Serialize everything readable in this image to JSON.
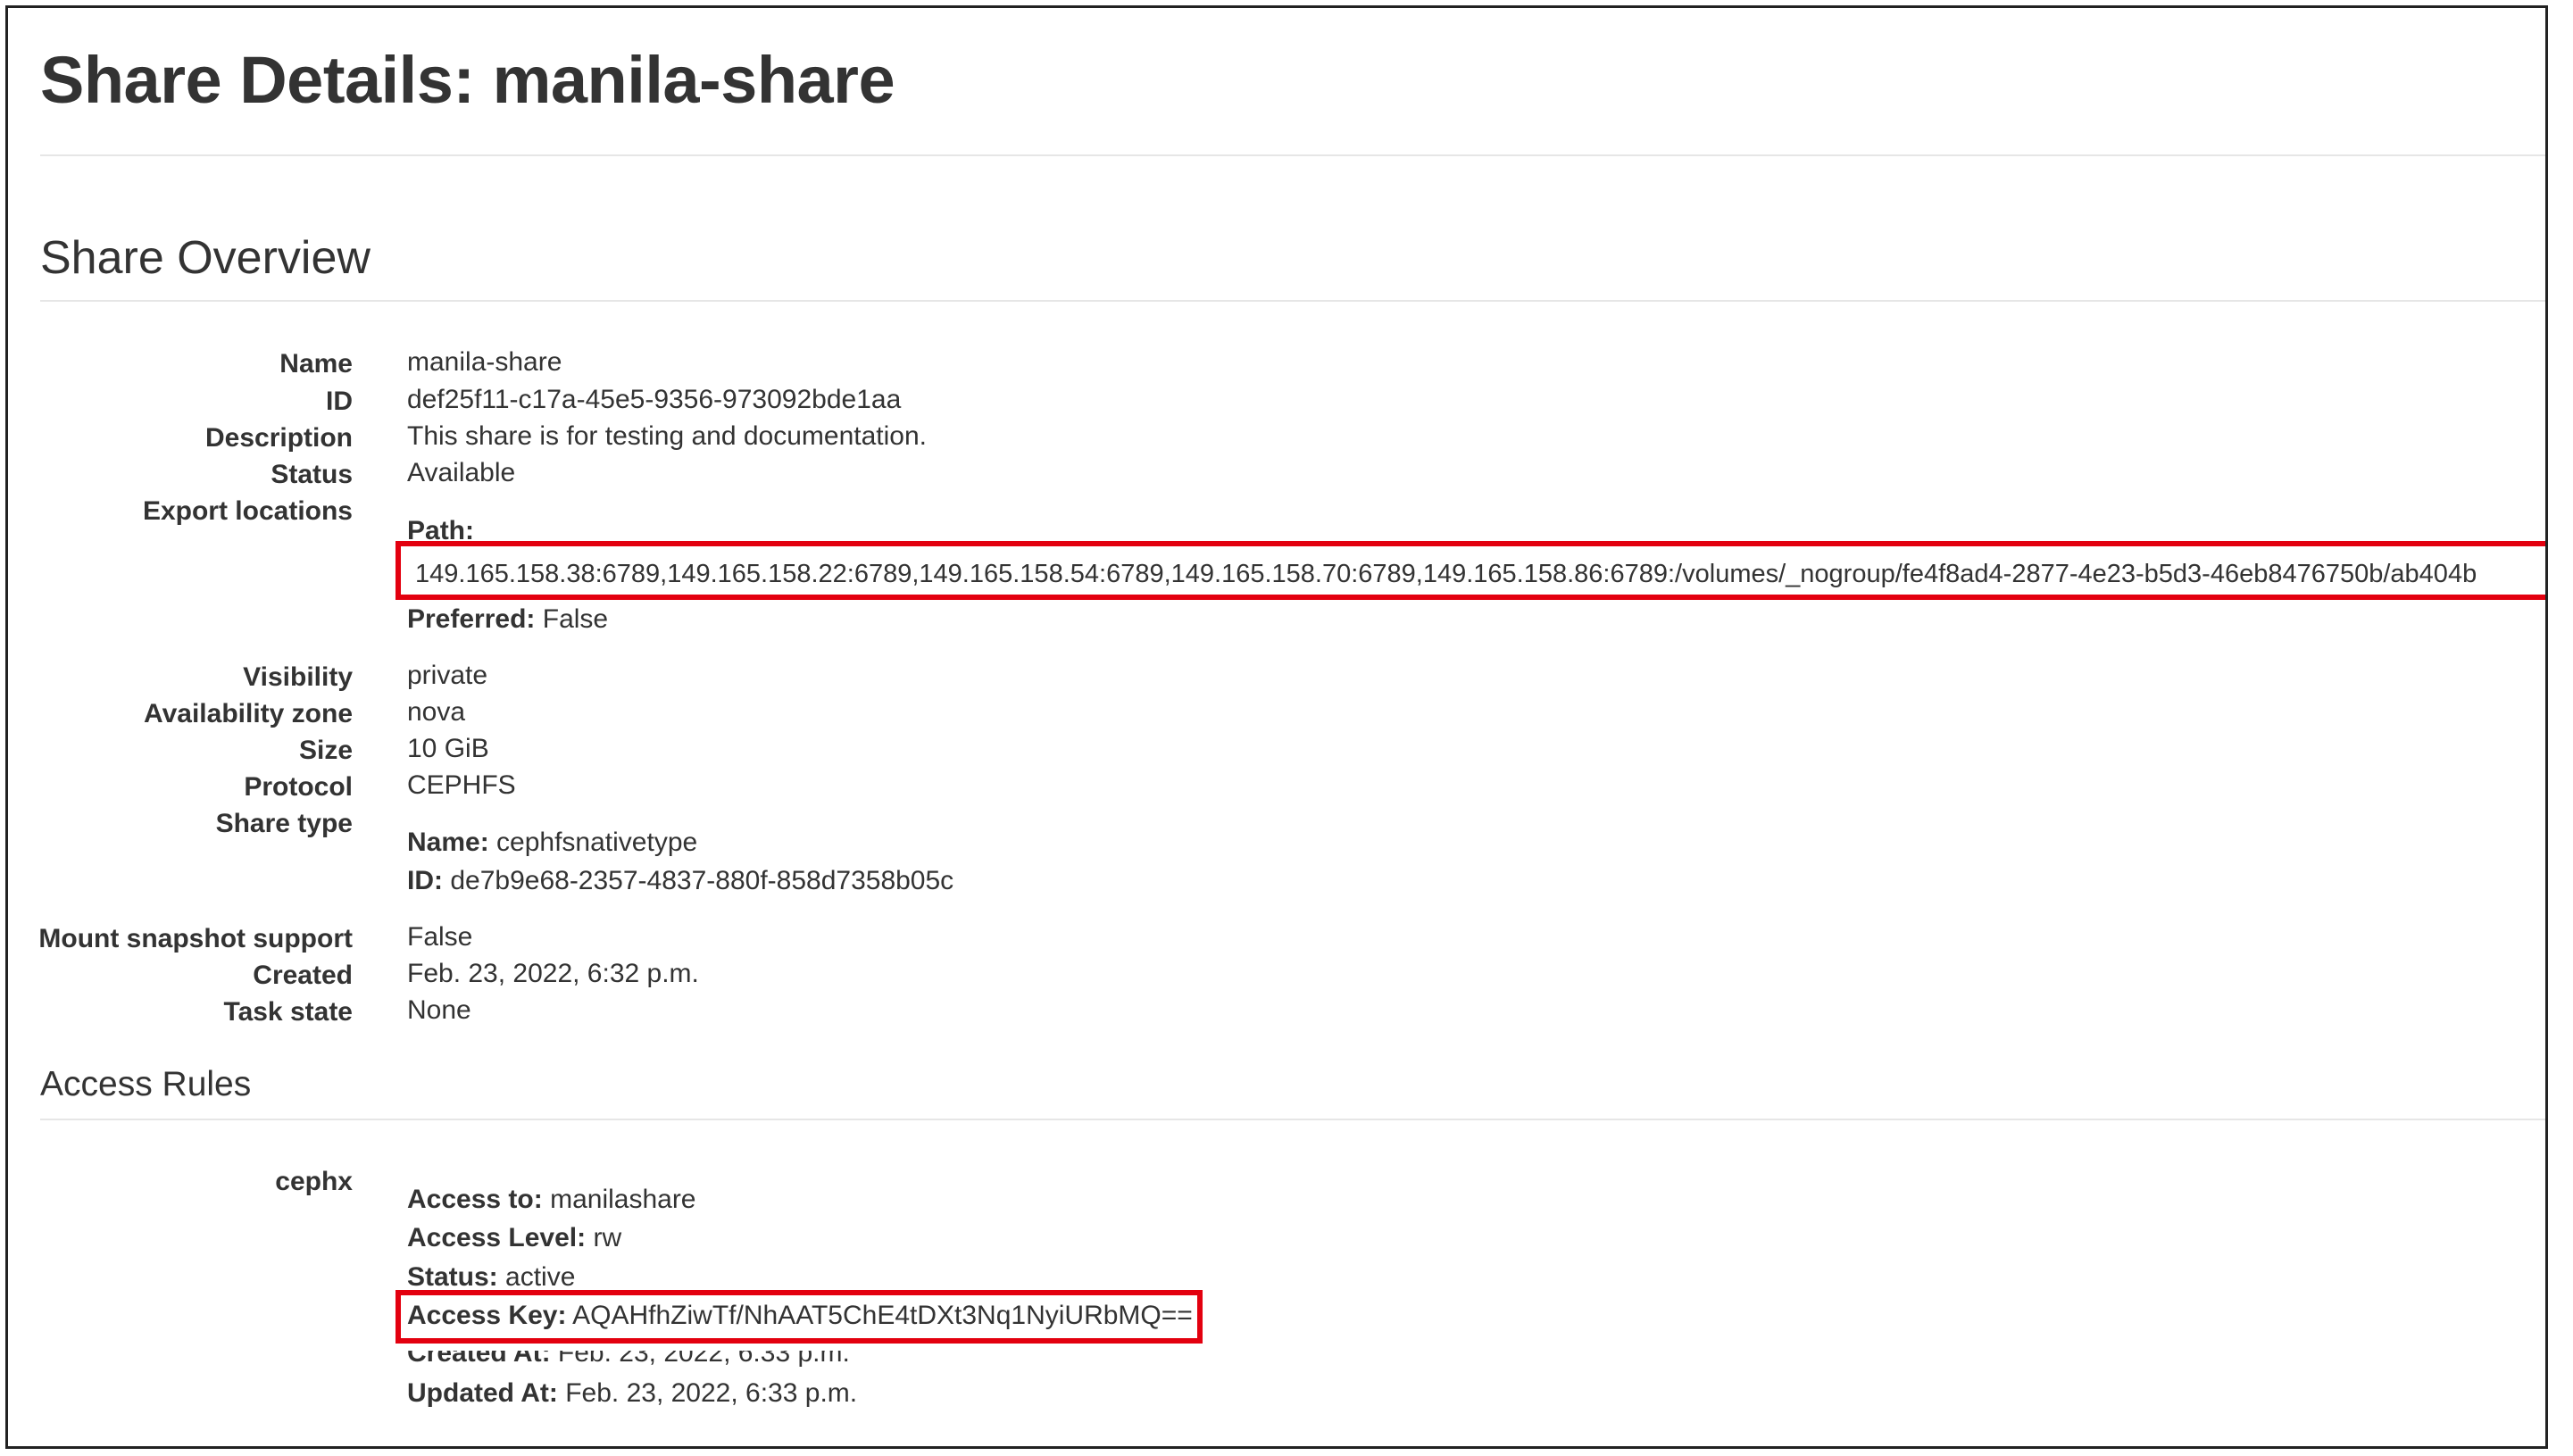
{
  "page_title": "Share Details: manila-share",
  "overview": {
    "title": "Share Overview",
    "name_label": "Name",
    "name": "manila-share",
    "id_label": "ID",
    "id": "def25f11-c17a-45e5-9356-973092bde1aa",
    "description_label": "Description",
    "description": "This share is for testing and documentation.",
    "status_label": "Status",
    "status": "Available",
    "export_label": "Export locations",
    "path_label": "Path:",
    "path": "149.165.158.38:6789,149.165.158.22:6789,149.165.158.54:6789,149.165.158.70:6789,149.165.158.86:6789:/volumes/_nogroup/fe4f8ad4-2877-4e23-b5d3-46eb8476750b/ab404b",
    "preferred_label": "Preferred:",
    "preferred": "False",
    "visibility_label": "Visibility",
    "visibility": "private",
    "az_label": "Availability zone",
    "az": "nova",
    "size_label": "Size",
    "size": "10 GiB",
    "protocol_label": "Protocol",
    "protocol": "CEPHFS",
    "share_type_label": "Share type",
    "type_name_label": "Name:",
    "type_name": "cephfsnativetype",
    "type_id_label": "ID:",
    "type_id": "de7b9e68-2357-4837-880f-858d7358b05c",
    "mount_label": "Mount snapshot support",
    "mount": "False",
    "created_label": "Created",
    "created": "Feb. 23, 2022, 6:32 p.m.",
    "task_label": "Task state",
    "task": "None"
  },
  "access": {
    "title": "Access Rules",
    "rule_type": "cephx",
    "access_to_label": "Access to:",
    "access_to": "manilashare",
    "level_label": "Access Level:",
    "level": "rw",
    "status_label": "Status:",
    "status": "active",
    "key_label": "Access Key:",
    "key": "AQAHfhZiwTf/NhAAT5ChE4tDXt3Nq1NyiURbMQ==",
    "created_label": "Created At:",
    "created": "Feb. 23, 2022, 6:33 p.m.",
    "updated_label": "Updated At:",
    "updated": "Feb. 23, 2022, 6:33 p.m."
  },
  "colors": {
    "highlight": "#e3000f",
    "text": "#333333",
    "rule": "#e6e6e6"
  }
}
